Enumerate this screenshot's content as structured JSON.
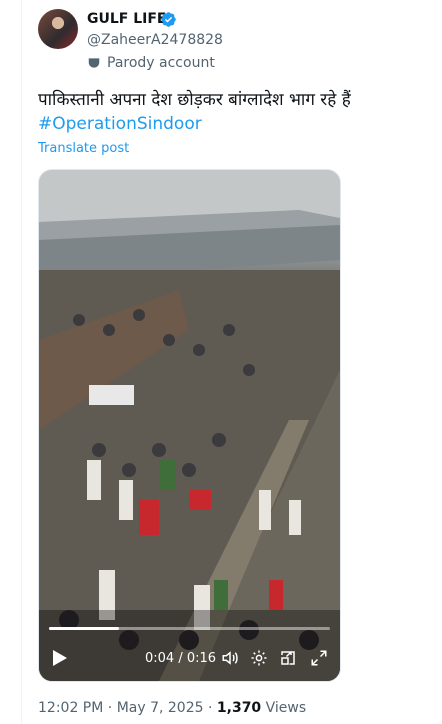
{
  "author": {
    "display_name": "GULF LIFE",
    "handle": "@ZaheerA2478828",
    "account_label": "Parody account",
    "verified_icon": "verified-badge-icon"
  },
  "post": {
    "text": "पाकिस्तानी अपना देश छोड़कर बांग्लादेश भाग रहे हैं",
    "hashtag": "#OperationSindoor",
    "translate_label": "Translate post"
  },
  "video": {
    "current_time": "0:04",
    "separator": "/",
    "duration": "0:16",
    "progress_fraction": 0.25,
    "icons": [
      "play-icon",
      "volume-icon",
      "settings-icon",
      "picture-in-picture-icon",
      "fullscreen-icon"
    ]
  },
  "meta": {
    "time": "12:02 PM",
    "date": "May 7, 2025",
    "views_count": "1,370",
    "views_label": "Views"
  },
  "colors": {
    "link": "#1d9bf0",
    "secondary_text": "#536471",
    "primary_text": "#0f1419"
  }
}
